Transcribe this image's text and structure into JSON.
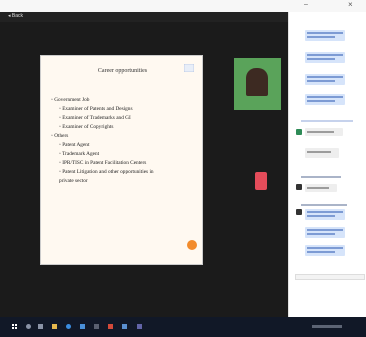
{
  "window": {
    "title": "",
    "min_glyph": "–",
    "close_glyph": "×"
  },
  "meeting": {
    "back_label": "◂  Back"
  },
  "slide": {
    "title": "Career opportunities",
    "bullets": [
      {
        "level": 1,
        "text": "◦ Government Job"
      },
      {
        "level": 2,
        "text": "◦ Examiner of Patents and Designs"
      },
      {
        "level": 2,
        "text": "◦ Examiner of Trademarks and GI"
      },
      {
        "level": 2,
        "text": "◦ Examiner of Copyrights"
      },
      {
        "level": 1,
        "text": "◦ Others"
      },
      {
        "level": 2,
        "text": "◦ Patent Agent"
      },
      {
        "level": 2,
        "text": "◦ Trademark Agent"
      },
      {
        "level": 2,
        "text": "◦ IPR/TISC in Patent Facilitation Centers"
      },
      {
        "level": 2,
        "text": "◦ Patent Litigation and other opportunities in"
      },
      {
        "level": 2,
        "text": "   private sector"
      }
    ]
  },
  "colors": {
    "meeting_bg": "#1b1b1b",
    "chat_bubble": "#d6e4fa",
    "accent_orange": "#f28b2c",
    "taskbar": "#111827"
  }
}
